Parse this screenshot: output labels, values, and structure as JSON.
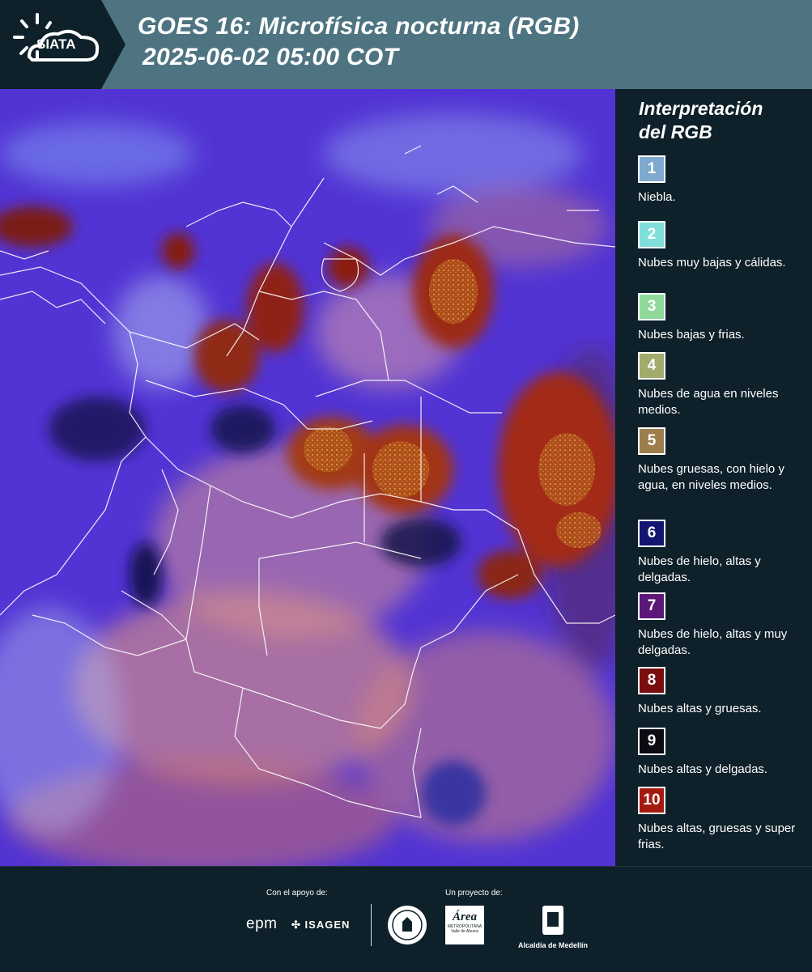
{
  "header": {
    "logo_text": "SIATA",
    "title_line1": "GOES 16: Microfísica nocturna (RGB)",
    "title_line2": "2025-06-02 05:00 COT"
  },
  "legend": {
    "title_line1": "Interpretación",
    "title_line2": "del RGB",
    "items": [
      {
        "num": "1",
        "color": "#7fa9cf",
        "label": "Niebla."
      },
      {
        "num": "2",
        "color": "#7fded9",
        "label": "Nubes muy bajas y cálidas."
      },
      {
        "num": "3",
        "color": "#8fd99b",
        "label": "Nubes bajas y frias."
      },
      {
        "num": "4",
        "color": "#a0ab6c",
        "label": "Nubes de agua en niveles medios."
      },
      {
        "num": "5",
        "color": "#9c7e4c",
        "label": "Nubes gruesas, con hielo y agua, en niveles medios."
      },
      {
        "num": "6",
        "color": "#131570",
        "label": "Nubes de hielo, altas y delgadas."
      },
      {
        "num": "7",
        "color": "#5c1878",
        "label": "Nubes de hielo, altas y muy delgadas."
      },
      {
        "num": "8",
        "color": "#7a0e0e",
        "label": "Nubes altas y gruesas."
      },
      {
        "num": "9",
        "color": "#0b0b14",
        "label": "Nubes altas y delgadas."
      },
      {
        "num": "10",
        "color": "#a31b10",
        "label": "Nubes altas, gruesas y super frias."
      }
    ]
  },
  "footer": {
    "support_label": "Con el apoyo de:",
    "project_label": "Un proyecto de:",
    "epm": "epm",
    "isagen": "ISAGEN",
    "area_name": "Área",
    "area_sub1": "METROPOLITANA",
    "area_sub2": "Valle de Aburrá",
    "alcaldia": "Alcaldía de Medellín"
  }
}
